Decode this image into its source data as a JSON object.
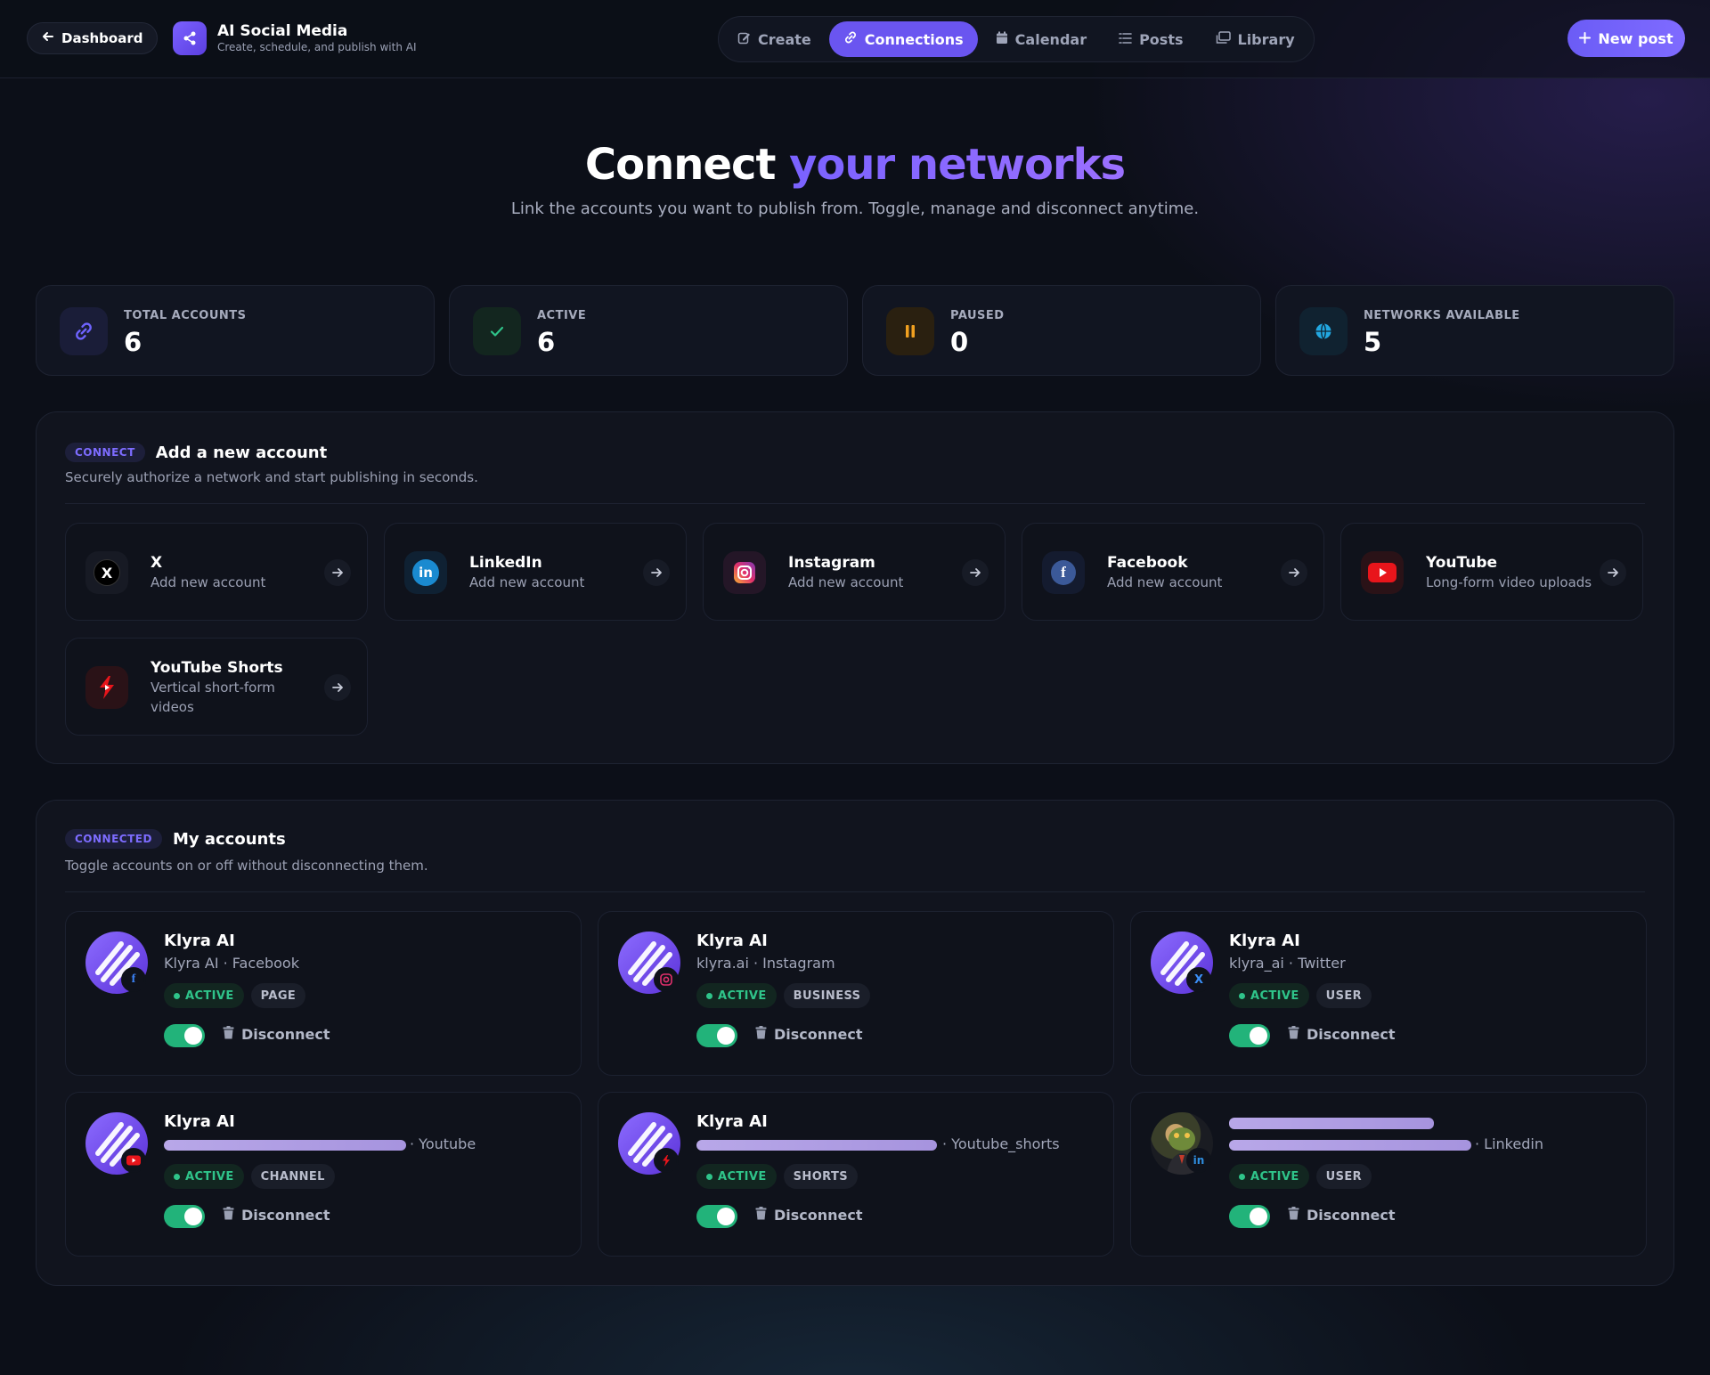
{
  "header": {
    "back_label": "Dashboard",
    "brand_title": "AI Social Media",
    "brand_subtitle": "Create, schedule, and publish with AI",
    "tabs": [
      {
        "label": "Create",
        "icon": "edit-icon"
      },
      {
        "label": "Connections",
        "icon": "link-icon",
        "active": true
      },
      {
        "label": "Calendar",
        "icon": "calendar-icon"
      },
      {
        "label": "Posts",
        "icon": "list-icon"
      },
      {
        "label": "Library",
        "icon": "library-icon"
      }
    ],
    "new_post_label": "New post"
  },
  "hero": {
    "title_start": "Connect",
    "title_highlight": "your networks",
    "subtitle": "Link the accounts you want to publish from. Toggle, manage and disconnect anytime."
  },
  "stats": [
    {
      "label": "TOTAL ACCOUNTS",
      "value": "6",
      "icon": "link-icon",
      "color": "#6e63ff"
    },
    {
      "label": "ACTIVE",
      "value": "6",
      "icon": "check-icon",
      "color": "#2fc48a"
    },
    {
      "label": "PAUSED",
      "value": "0",
      "icon": "pause-icon",
      "color": "#f0a020"
    },
    {
      "label": "NETWORKS AVAILABLE",
      "value": "5",
      "icon": "globe-icon",
      "color": "#22a7e0"
    }
  ],
  "connect": {
    "pill": "CONNECT",
    "title": "Add a new account",
    "description": "Securely authorize a network and start publishing in seconds.",
    "networks": [
      {
        "name": "X",
        "description": "Add new account",
        "icon": "x-icon"
      },
      {
        "name": "LinkedIn",
        "description": "Add new account",
        "icon": "linkedin-icon"
      },
      {
        "name": "Instagram",
        "description": "Add new account",
        "icon": "instagram-icon"
      },
      {
        "name": "Facebook",
        "description": "Add new account",
        "icon": "facebook-icon"
      },
      {
        "name": "YouTube",
        "description": "Long-form video uploads",
        "icon": "youtube-icon"
      },
      {
        "name": "YouTube Shorts",
        "description": "Vertical short-form videos",
        "icon": "youtube-shorts-icon"
      }
    ]
  },
  "accounts": {
    "pill": "CONNECTED",
    "title": "My accounts",
    "description": "Toggle accounts on or off without disconnecting them.",
    "disconnect_label": "Disconnect",
    "active_label": "ACTIVE",
    "items": [
      {
        "name": "Klyra AI",
        "subtitle": "Klyra AI · Facebook",
        "type": "PAGE",
        "network_icon": "facebook-icon",
        "enabled": true
      },
      {
        "name": "Klyra AI",
        "subtitle": "klyra.ai · Instagram",
        "type": "BUSINESS",
        "network_icon": "instagram-icon",
        "enabled": true
      },
      {
        "name": "Klyra AI",
        "subtitle": "klyra_ai · Twitter",
        "type": "USER",
        "network_icon": "x-icon",
        "enabled": true
      },
      {
        "name": "Klyra AI",
        "subtitle": "· Youtube",
        "type": "CHANNEL",
        "network_icon": "youtube-icon",
        "enabled": true
      },
      {
        "name": "Klyra AI",
        "subtitle": "· Youtube_shorts",
        "type": "SHORTS",
        "network_icon": "youtube-shorts-icon",
        "enabled": true
      },
      {
        "name": "",
        "subtitle": "· Linkedin",
        "type": "USER",
        "network_icon": "linkedin-icon",
        "enabled": true
      }
    ]
  }
}
